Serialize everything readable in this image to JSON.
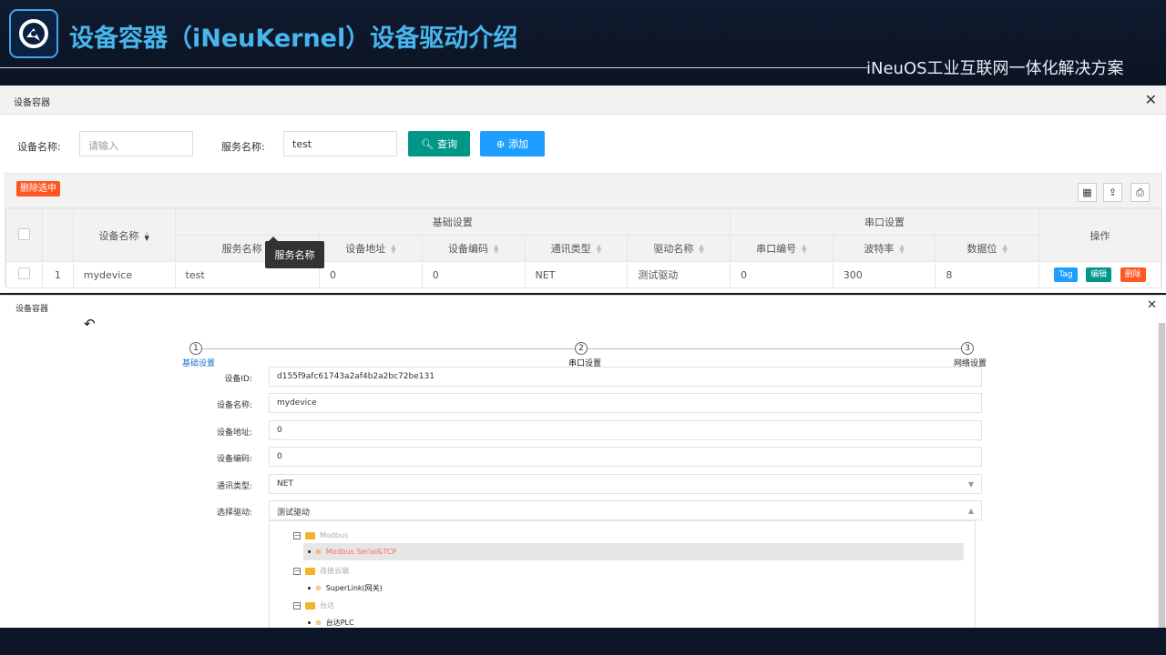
{
  "header": {
    "title": "设备容器（iNeuKernel）设备驱动介绍",
    "subtitle": "iNeuOS工业互联网一体化解决方案"
  },
  "list_panel": {
    "title": "设备容器",
    "search": {
      "device_name_label": "设备名称:",
      "device_name_placeholder": "请输入",
      "service_name_label": "服务名称:",
      "service_name_value": "test",
      "query_button": "查询",
      "add_button": "添加"
    },
    "toolbar": {
      "delete_selected": "删除选中"
    },
    "table": {
      "group_basic": "基础设置",
      "group_serial": "串口设置",
      "col_device_name": "设备名称",
      "col_operation": "操作",
      "columns": [
        "服务名称",
        "设备地址",
        "设备编码",
        "通讯类型",
        "驱动名称",
        "串口编号",
        "波特率",
        "数据位"
      ],
      "rows": [
        {
          "index": "1",
          "device_name": "mydevice",
          "service_name": "test",
          "address": "0",
          "code": "0",
          "comm_type": "NET",
          "driver": "测试驱动",
          "port": "0",
          "baud": "300",
          "data_bits": "8"
        }
      ],
      "actions": [
        "Tag",
        "编辑",
        "删除"
      ],
      "tooltip": "服务名称"
    }
  },
  "edit_panel": {
    "title": "设备容器",
    "steps": [
      {
        "num": "1",
        "label": "基础设置"
      },
      {
        "num": "2",
        "label": "串口设置"
      },
      {
        "num": "3",
        "label": "网络设置"
      }
    ],
    "fields": [
      {
        "label": "设备ID:",
        "value": "d155f9afc61743a2af4b2a2bc72be131"
      },
      {
        "label": "设备名称:",
        "value": "mydevice"
      },
      {
        "label": "设备地址:",
        "value": "0"
      },
      {
        "label": "设备编码:",
        "value": "0"
      },
      {
        "label": "通讯类型:",
        "value": "NET"
      },
      {
        "label": "选择驱动:",
        "value": "测试驱动"
      }
    ],
    "tree": [
      {
        "group": "Modbus",
        "items": [
          "Modbus Serial&TCP"
        ]
      },
      {
        "group": "连接云端",
        "items": [
          "SuperLink(网关)"
        ]
      },
      {
        "group": "台达",
        "items": [
          "台达PLC"
        ]
      }
    ]
  },
  "colors": {
    "accent_blue": "#1e9fff",
    "green": "#009688",
    "danger": "#ff5722",
    "selected_item": "#ff6a6a"
  }
}
